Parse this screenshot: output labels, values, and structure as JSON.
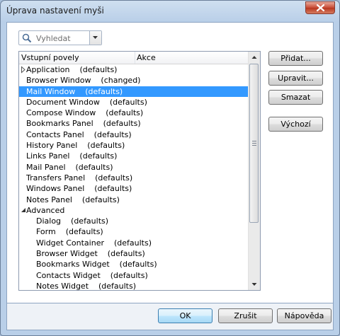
{
  "window": {
    "title": "Úprava nastavení myši"
  },
  "search": {
    "placeholder": "Vyhledat"
  },
  "list": {
    "columns": [
      "Vstupní povely",
      "Akce"
    ],
    "rows": [
      {
        "label": "Application    (defaults)",
        "indent": 1,
        "expander": "collapsed",
        "selected": false
      },
      {
        "label": "Browser Window    (changed)",
        "indent": 1,
        "selected": false
      },
      {
        "label": "Mail Window    (defaults)",
        "indent": 1,
        "selected": true
      },
      {
        "label": "Document Window    (defaults)",
        "indent": 1,
        "selected": false
      },
      {
        "label": "Compose Window    (defaults)",
        "indent": 1,
        "selected": false
      },
      {
        "label": "Bookmarks Panel    (defaults)",
        "indent": 1,
        "selected": false
      },
      {
        "label": "Contacts Panel    (defaults)",
        "indent": 1,
        "selected": false
      },
      {
        "label": "History Panel    (defaults)",
        "indent": 1,
        "selected": false
      },
      {
        "label": "Links Panel    (defaults)",
        "indent": 1,
        "selected": false
      },
      {
        "label": "Mail Panel    (defaults)",
        "indent": 1,
        "selected": false
      },
      {
        "label": "Transfers Panel    (defaults)",
        "indent": 1,
        "selected": false
      },
      {
        "label": "Windows Panel    (defaults)",
        "indent": 1,
        "selected": false
      },
      {
        "label": "Notes Panel    (defaults)",
        "indent": 1,
        "selected": false
      },
      {
        "label": "Advanced",
        "indent": 1,
        "expander": "expanded",
        "selected": false
      },
      {
        "label": "Dialog    (defaults)",
        "indent": 2,
        "selected": false
      },
      {
        "label": "Form    (defaults)",
        "indent": 2,
        "selected": false
      },
      {
        "label": "Widget Container    (defaults)",
        "indent": 2,
        "selected": false
      },
      {
        "label": "Browser Widget    (defaults)",
        "indent": 2,
        "selected": false
      },
      {
        "label": "Bookmarks Widget    (defaults)",
        "indent": 2,
        "selected": false
      },
      {
        "label": "Contacts Widget    (defaults)",
        "indent": 2,
        "selected": false
      },
      {
        "label": "Notes Widget    (defaults)",
        "indent": 2,
        "selected": false
      }
    ]
  },
  "side_buttons": {
    "add": "Přidat...",
    "edit": "Upravit...",
    "delete": "Smazat",
    "default": "Výchozí"
  },
  "footer": {
    "ok": "OK",
    "cancel": "Zrušit",
    "help": "Nápověda"
  },
  "colors": {
    "selection": "#3399ff",
    "frame": "#b9cfe8",
    "close_button": "#c74a35"
  }
}
